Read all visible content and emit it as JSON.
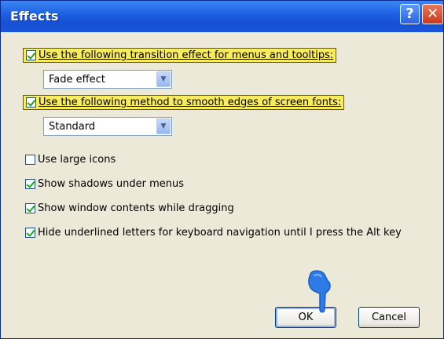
{
  "window": {
    "title": "Effects",
    "help_glyph": "?",
    "close_glyph": "✕"
  },
  "options": {
    "transition": {
      "label": "Use the following transition effect for menus and tooltips:",
      "checked": true,
      "selected": "Fade effect"
    },
    "smooth_fonts": {
      "label": "Use the following method to smooth edges of screen fonts:",
      "checked": true,
      "selected": "Standard"
    },
    "large_icons": {
      "label": "Use large icons",
      "checked": false
    },
    "shadows": {
      "label": "Show shadows under menus",
      "checked": true
    },
    "drag_contents": {
      "label": "Show window contents while dragging",
      "checked": true
    },
    "hide_underlines": {
      "label": "Hide underlined letters for keyboard navigation until I press the Alt key",
      "checked": true
    }
  },
  "buttons": {
    "ok": "OK",
    "cancel": "Cancel"
  },
  "colors": {
    "highlight": "#f8ec5c",
    "titlebar": "#1c5fe0",
    "pointer": "#2e7be8",
    "check": "#21a121"
  },
  "icons": {
    "help": "help-icon",
    "close": "close-icon",
    "combo_arrow": "chevron-down-icon",
    "pointer": "hand-pointer-icon"
  }
}
